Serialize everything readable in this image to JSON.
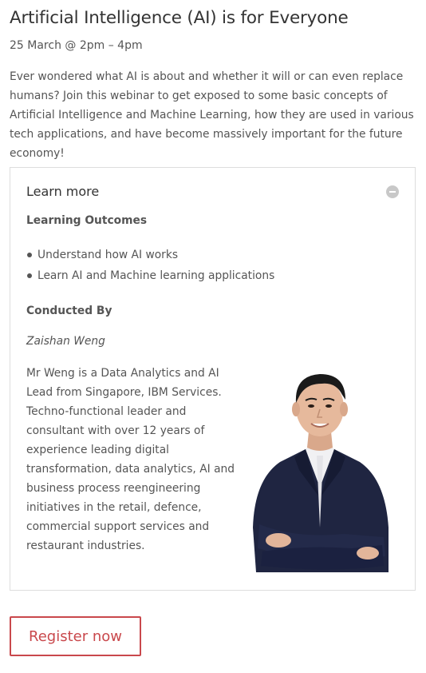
{
  "event": {
    "title": "Artificial Intelligence (AI) is for Everyone",
    "date": "25 March @ 2pm – 4pm",
    "description": "Ever wondered what AI is about and whether it will or can even replace humans? Join this webinar to get exposed to some basic concepts of Artificial Intelligence and Machine Learning, how they are used in various tech applications, and have become massively important for the future economy!"
  },
  "accordion": {
    "title": "Learn more",
    "toggle_icon": "minus-circle-icon",
    "outcomes_heading": "Learning Outcomes",
    "outcomes": [
      "Understand how AI works",
      "Learn AI and Machine learning applications"
    ],
    "conducted_heading": "Conducted By",
    "speaker_name": "Zaishan Weng",
    "speaker_bio": "Mr Weng is a Data Analytics and AI Lead from Singapore, IBM Services. Techno-functional leader and consultant with over 12 years of experience leading digital transformation, data analytics, AI and business process reengineering initiatives in the retail, defence, commercial support services and restaurant industries."
  },
  "register": {
    "label": "Register now",
    "accent_color": "#c9484c"
  }
}
